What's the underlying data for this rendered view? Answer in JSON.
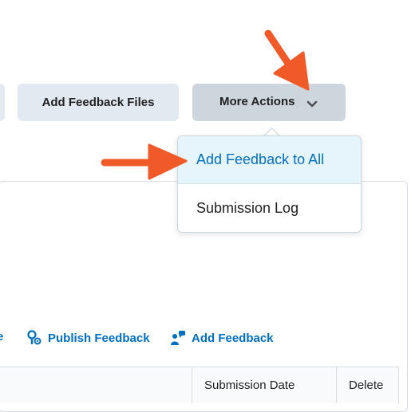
{
  "toolbar": {
    "add_feedback_files_label": "Add Feedback Files",
    "more_actions_label": "More Actions"
  },
  "menu": {
    "items": [
      {
        "label": "Add Feedback to All",
        "active": true
      },
      {
        "label": "Submission Log",
        "active": false
      }
    ]
  },
  "actions": {
    "partial_link_text": "e",
    "publish_feedback_label": "Publish Feedback",
    "add_feedback_label": "Add Feedback"
  },
  "table": {
    "columns": [
      "Submission Date",
      "Delete"
    ]
  },
  "colors": {
    "annotation_arrow": "#f05a28",
    "link_blue": "#006fbf",
    "button_bg": "#e3e9f1",
    "button_active_bg": "#cdd5dd"
  }
}
